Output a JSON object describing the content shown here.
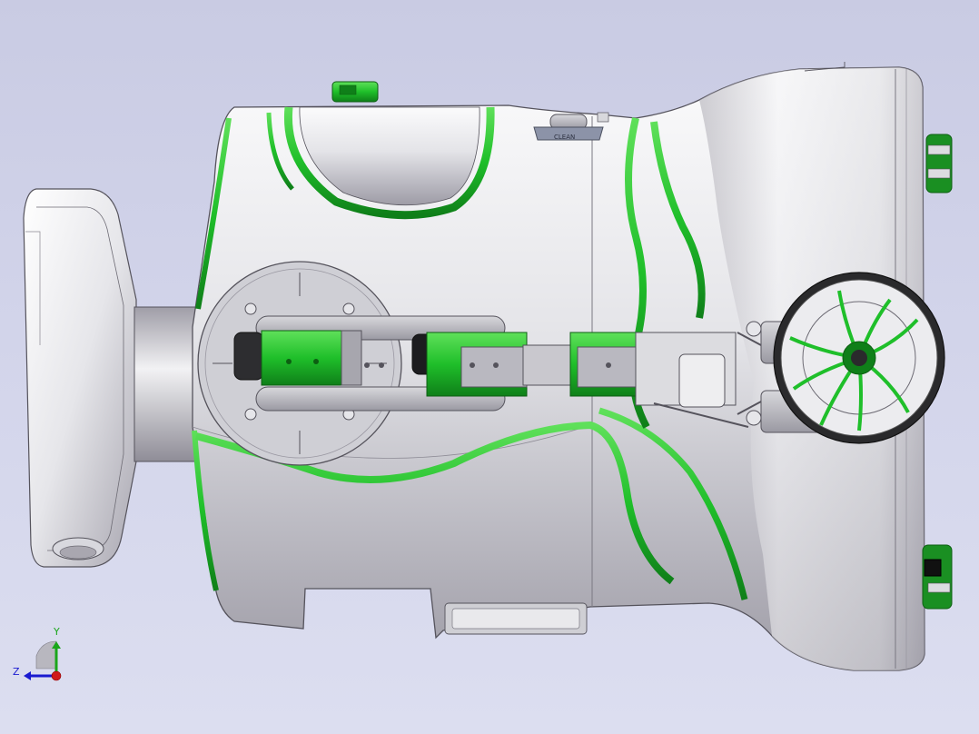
{
  "viewport": {
    "background_top": "#c9cbe3",
    "background_bottom": "#dcdef0"
  },
  "model": {
    "shell_color": "#e6e6ea",
    "accent_color": "#1fbf2a",
    "dark_accent_color": "#0f7f19",
    "wheel_color": "#2a2a2a",
    "panel_label": "CLEAN"
  },
  "triad": {
    "y_label": "Y",
    "z_label": "Z",
    "y_color": "#1aa61a",
    "z_color": "#1a1ad0",
    "x_color": "#d01a1a"
  }
}
